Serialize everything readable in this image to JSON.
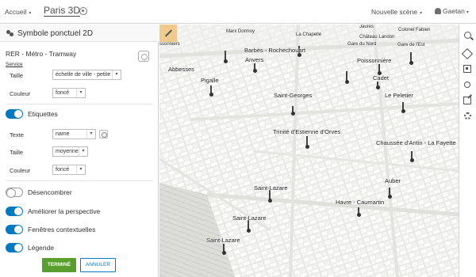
{
  "topbar": {
    "home_label": "Accueil",
    "home_caret": "▾",
    "scene_title": "Paris 3D",
    "new_scene_label": "Nouvelle scène",
    "new_scene_caret": "▾",
    "user_name": "Gaetan",
    "user_caret": "▾"
  },
  "panel": {
    "title": "Symbole ponctuel 2D",
    "layer_name": "RER - Métro - Tramway",
    "service_link": "Service",
    "size_label": "Taille",
    "size_value": "échelle de ville - petite",
    "color_label": "Couleur",
    "color_value": "foncé",
    "labels_toggle": "Etiquettes",
    "labels_on": true,
    "text_label": "Texte",
    "text_value": "name",
    "label_size_label": "Taille",
    "label_size_value": "moyenne",
    "label_color_label": "Couleur",
    "label_color_value": "foncé",
    "declutter_label": "Désencombrer",
    "declutter_on": false,
    "perspective_label": "Améliorer la perspective",
    "perspective_on": true,
    "popups_label": "Fenêtres contextuelles",
    "popups_on": true,
    "legend_label": "Légende",
    "legend_on": true,
    "done_button": "TERMINÉ",
    "cancel_button": "ANNULER",
    "dropdown_arrow": "▾"
  },
  "map": {
    "labels": [
      {
        "text": "Marx Dormoy",
        "small": true
      },
      {
        "text": "La Chapelle",
        "small": true
      },
      {
        "text": "Jaurès",
        "small": true
      },
      {
        "text": "Colonel Fabien",
        "small": true
      },
      {
        "text": "Château Landon",
        "small": true
      },
      {
        "text": "Gare du Nord",
        "small": true
      },
      {
        "text": "Gare de l'Est",
        "small": true
      },
      {
        "text": "Barbès - Rochechouart",
        "small": false
      },
      {
        "text": "Anvers",
        "small": false
      },
      {
        "text": "Poissonnière",
        "small": false
      },
      {
        "text": "Abbesses",
        "small": false
      },
      {
        "text": "Pigalle",
        "small": false
      },
      {
        "text": "Cadet",
        "small": false
      },
      {
        "text": "Saint-Georges",
        "small": false
      },
      {
        "text": "Le Peletier",
        "small": false
      },
      {
        "text": "Trinité d'Estienne d'Orves",
        "small": false
      },
      {
        "text": "Chaussée d'Antin - La Fayette",
        "small": false
      },
      {
        "text": "Auber",
        "small": false
      },
      {
        "text": "Saint-Lazare",
        "small": false
      },
      {
        "text": "Havre - Caumartin",
        "small": false
      },
      {
        "text": "Saint-Lazare",
        "small": false
      },
      {
        "text": "Saint-Lazare",
        "small": false
      },
      {
        "text": "ssonniers",
        "small": true
      }
    ]
  },
  "tools": [
    "search-icon",
    "layers-icon",
    "basemap-icon",
    "daylight-icon",
    "share-icon",
    "settings-icon"
  ]
}
